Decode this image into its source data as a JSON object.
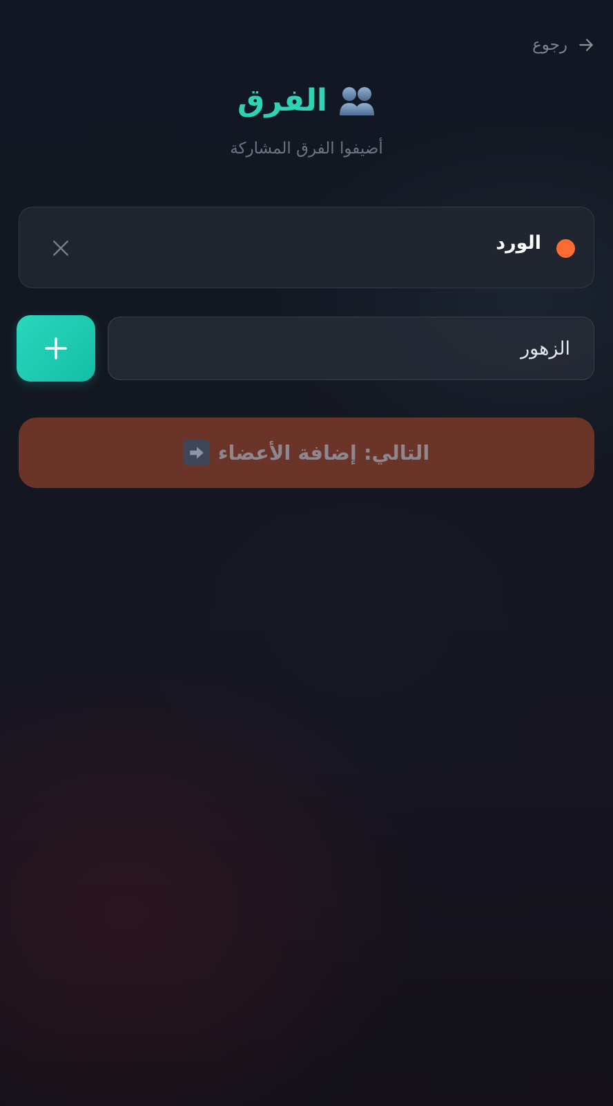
{
  "header": {
    "back_label": "رجوع",
    "title": "الفرق",
    "subtitle": "أضيفوا الفرق المشاركة"
  },
  "teams": [
    {
      "name": "الورد",
      "color": "#fb6c33"
    }
  ],
  "new_team_input": {
    "value": "الزهور"
  },
  "next_button": {
    "label": "التالي: إضافة الأعضاء"
  },
  "colors": {
    "accent": "#2ed3b5",
    "add_button": "#1cc9b0",
    "next_button_bg": "#6b3429",
    "team_dot": "#fb6c33"
  },
  "icons": [
    "arrow-right-icon",
    "people-icon",
    "close-icon",
    "plus-icon",
    "arrow-right-box-icon"
  ]
}
